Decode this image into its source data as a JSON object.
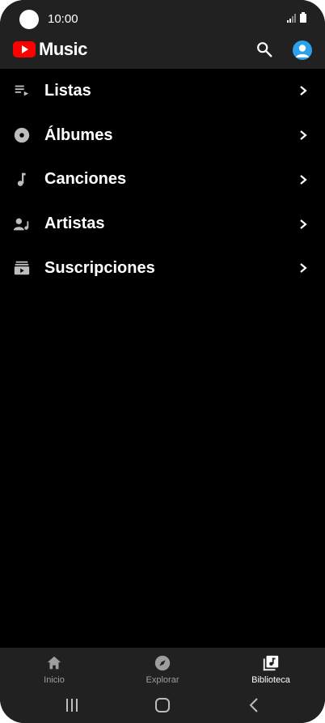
{
  "status_bar": {
    "time": "10:00"
  },
  "header": {
    "app_name": "Music",
    "icons": [
      "youtube-music-logo",
      "search-icon",
      "account-avatar-icon"
    ]
  },
  "library": {
    "items": [
      {
        "label": "Listas",
        "icon": "playlist-icon"
      },
      {
        "label": "Álbumes",
        "icon": "album-icon"
      },
      {
        "label": "Canciones",
        "icon": "music-note-icon"
      },
      {
        "label": "Artistas",
        "icon": "artist-icon"
      },
      {
        "label": "Suscripciones",
        "icon": "subscriptions-icon"
      }
    ]
  },
  "bottom_nav": {
    "tabs": [
      {
        "label": "Inicio",
        "icon": "home-icon",
        "active": false
      },
      {
        "label": "Explorar",
        "icon": "compass-icon",
        "active": false
      },
      {
        "label": "Biblioteca",
        "icon": "library-icon",
        "active": true
      }
    ]
  },
  "colors": {
    "background": "#000000",
    "bar": "#212121",
    "brand_red": "#ff0000",
    "avatar": "#2aa1e8",
    "inactive_text": "#9e9e9e"
  }
}
